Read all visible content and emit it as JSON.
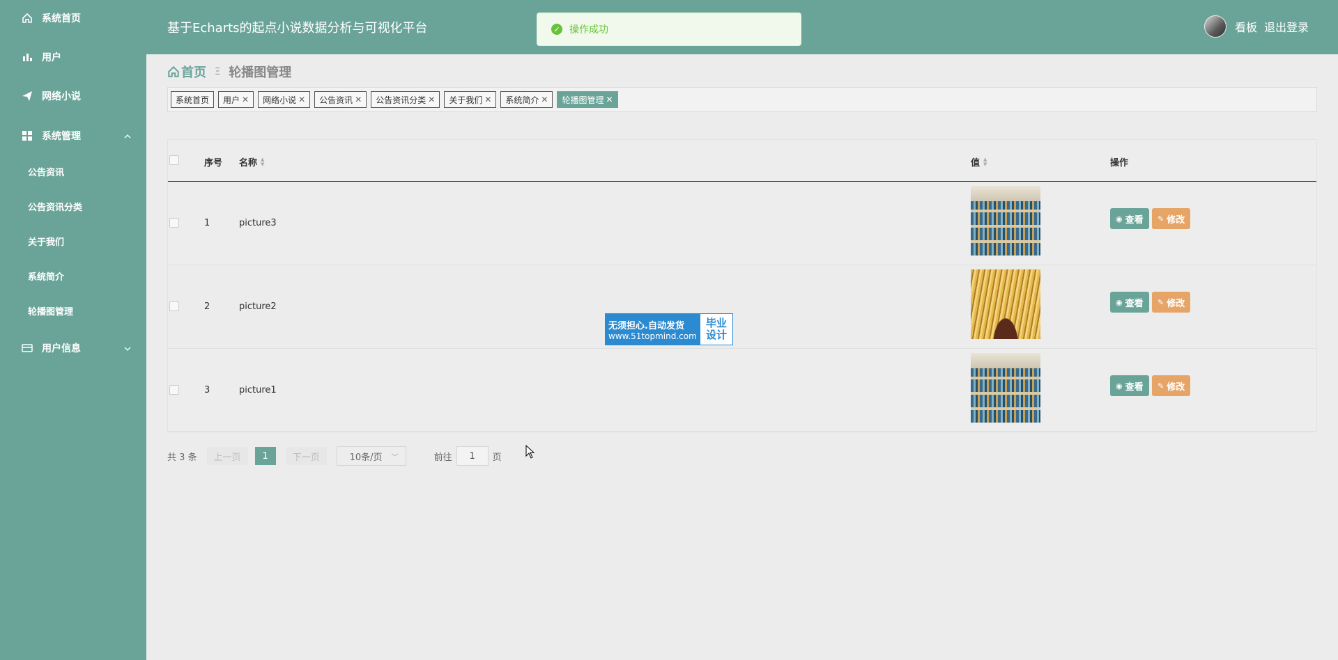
{
  "sidebar": {
    "items": [
      {
        "label": "系统首页",
        "icon": "home-icon"
      },
      {
        "label": "用户",
        "icon": "bar-chart-icon"
      },
      {
        "label": "网络小说",
        "icon": "paper-plane-icon"
      },
      {
        "label": "系统管理",
        "icon": "grid-icon"
      },
      {
        "label": "用户信息",
        "icon": "card-icon"
      }
    ],
    "sub_items": [
      "公告资讯",
      "公告资讯分类",
      "关于我们",
      "系统简介",
      "轮播图管理"
    ]
  },
  "header": {
    "title": "基于Echarts的起点小说数据分析与可视化平台",
    "board_link": "看板",
    "logout_link": "退出登录"
  },
  "toast": {
    "message": "操作成功"
  },
  "breadcrumb": {
    "home": "首页",
    "separator": "Ξ",
    "current": "轮播图管理"
  },
  "tags": [
    "系统首页",
    "用户",
    "网络小说",
    "公告资讯",
    "公告资讯分类",
    "关于我们",
    "系统简介",
    "轮播图管理"
  ],
  "table": {
    "headers": {
      "index": "序号",
      "name": "名称",
      "value": "值",
      "actions": "操作"
    },
    "rows": [
      {
        "index": "1",
        "name": "picture3",
        "image": "bookshelf"
      },
      {
        "index": "2",
        "name": "picture2",
        "image": "open-book"
      },
      {
        "index": "3",
        "name": "picture1",
        "image": "bookshelf"
      }
    ],
    "view_label": "查看",
    "edit_label": "修改"
  },
  "watermark": {
    "line1": "无须担心.自动发货",
    "line2": "www.51topmind.com",
    "side1": "毕业",
    "side2": "设计"
  },
  "pager": {
    "total": "共 3 条",
    "prev": "上一页",
    "current": "1",
    "next": "下一页",
    "page_size": "10条/页",
    "goto_prefix": "前往",
    "goto_value": "1",
    "goto_suffix": "页"
  },
  "colors": {
    "primary": "#6aa499",
    "edit": "#e6a566",
    "success": "#67c23a"
  }
}
